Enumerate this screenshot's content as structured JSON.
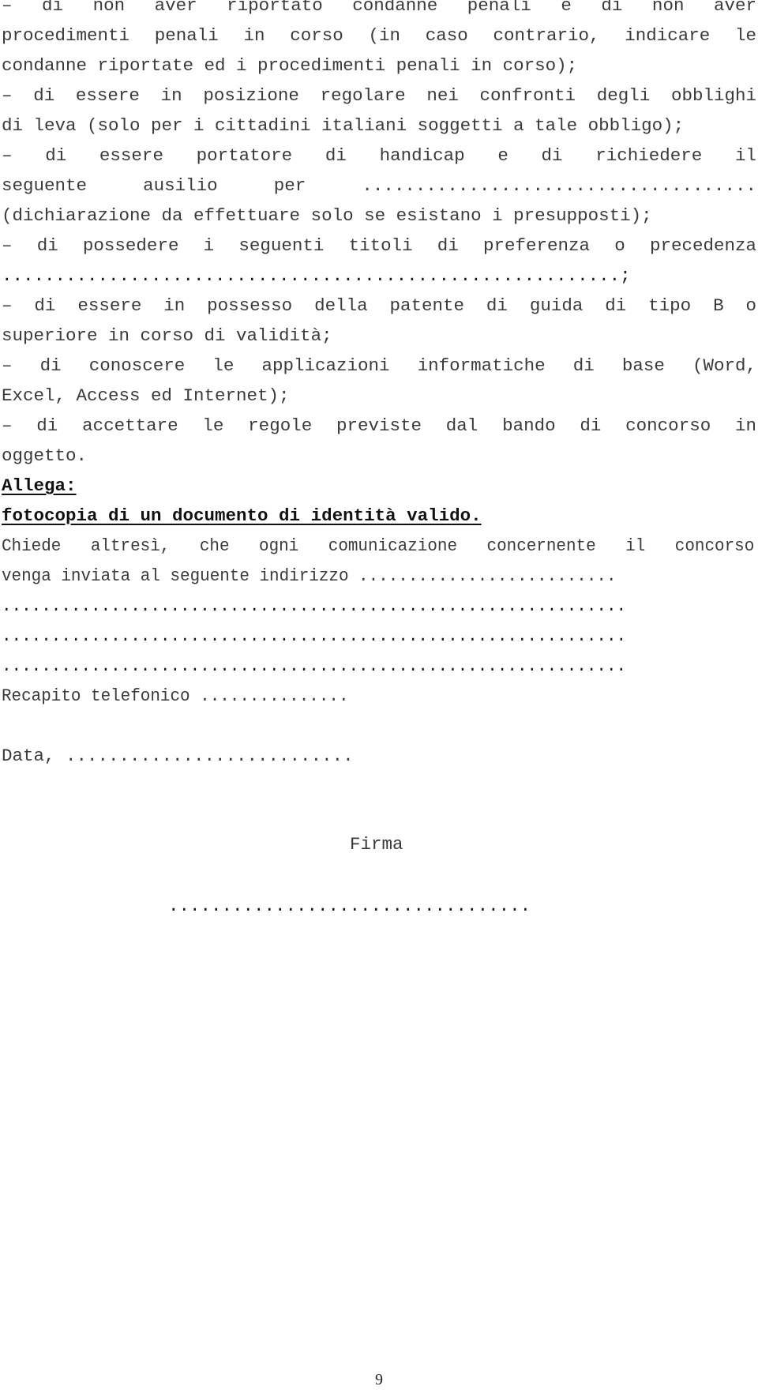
{
  "document": {
    "declarations": [
      {
        "lines": [
          "– di non aver riportato condanne penali e di non aver",
          "procedimenti penali in corso (in caso contrario, indicare le",
          "condanne riportate ed i procedimenti penali in corso);"
        ]
      },
      {
        "lines": [
          "– di essere in posizione regolare nei confronti degli obblighi",
          "di leva (solo per i cittadini italiani soggetti a tale obbligo);"
        ]
      },
      {
        "lines": [
          "– di essere portatore di handicap e di richiedere il",
          "seguente ausilio per .....................................",
          "(dichiarazione da effettuare solo se esistano i presupposti);"
        ]
      },
      {
        "lines": [
          "– di possedere i seguenti titoli di preferenza o precedenza",
          "..........................................................;"
        ]
      },
      {
        "lines": [
          "– di essere in possesso della patente di guida di tipo B o",
          "superiore in corso di validità;"
        ]
      },
      {
        "lines": [
          "– di conoscere le applicazioni informatiche di base (Word,",
          "Excel, Access ed Internet);"
        ]
      },
      {
        "lines": [
          "– di accettare le regole previste dal bando di concorso in",
          "oggetto."
        ]
      }
    ],
    "attachments": {
      "heading": "Allega:",
      "item": "fotocopia di un documento di identità valido."
    },
    "address_request": {
      "lines": [
        "Chiede altresì, che ogni comunicazione concernente il concorso",
        "venga inviata al seguente indirizzo ..........................",
        "...............................................................",
        "...............................................................",
        "..............................................................."
      ]
    },
    "phone": "Recapito telefonico ...............",
    "date": "Data, ...........................",
    "signature_label": "Firma",
    "signature_line": "..................................",
    "page_number": "9"
  }
}
